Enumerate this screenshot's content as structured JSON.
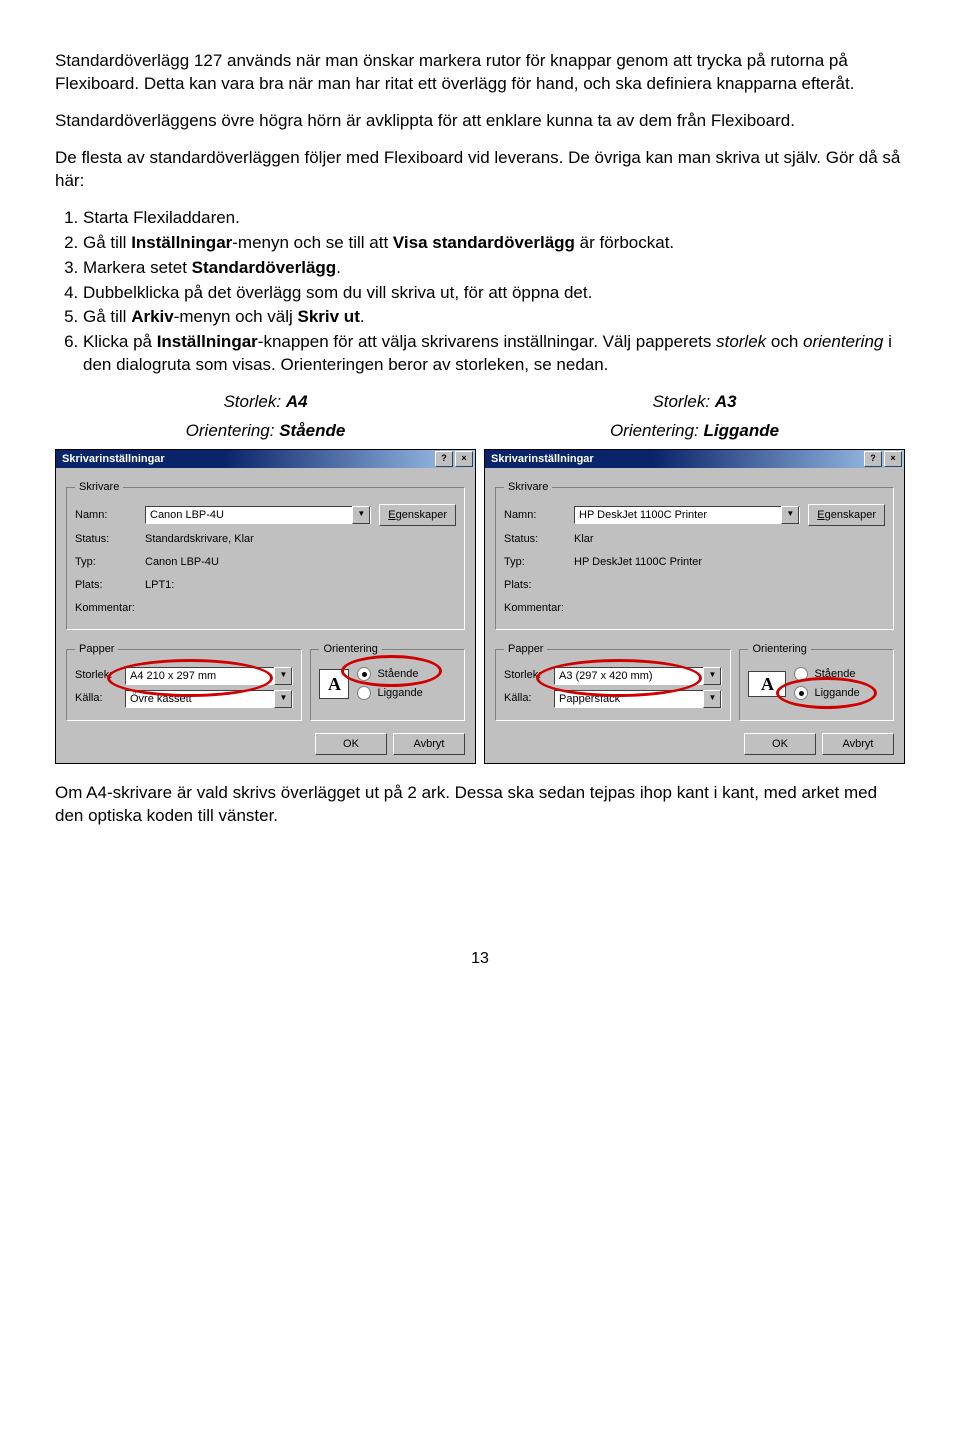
{
  "intro": {
    "p1": "Standardöverlägg 127 används när man önskar markera rutor för knappar genom att trycka på rutorna på Flexiboard. Detta kan vara bra när man har ritat ett överlägg för hand, och ska definiera knapparna efteråt.",
    "p2": "Standardöverläggens övre högra hörn är avklippta för att enklare kunna ta av dem från Flexiboard.",
    "p3": "De flesta av standardöverläggen följer med Flexiboard vid leverans. De övriga kan man skriva ut själv. Gör då så här:"
  },
  "steps": {
    "s1": "Starta Flexiladdaren.",
    "s2_a": "Gå till ",
    "s2_b": "Inställningar",
    "s2_c": "-menyn och se till att ",
    "s2_d": "Visa standardöverlägg",
    "s2_e": " är förbockat.",
    "s3_a": "Markera setet ",
    "s3_b": "Standardöverlägg",
    "s3_c": ".",
    "s4": "Dubbelklicka på det överlägg som du vill skriva ut, för att öppna det.",
    "s5_a": "Gå till ",
    "s5_b": "Arkiv",
    "s5_c": "-menyn och välj ",
    "s5_d": "Skriv ut",
    "s5_e": ".",
    "s6_a": "Klicka på ",
    "s6_b": "Inställningar",
    "s6_c": "-knappen för att välja skrivarens inställningar. Välj papperets ",
    "s6_d": "storlek",
    "s6_e": " och ",
    "s6_f": "orientering",
    "s6_g": " i den dialogruta som visas. Orienteringen beror av storleken, se nedan."
  },
  "headers": {
    "left1_a": "Storlek: ",
    "left1_b": "A4",
    "left2_a": "Orientering: ",
    "left2_b": "Stående",
    "right1_a": "Storlek: ",
    "right1_b": "A3",
    "right2_a": "Orientering: ",
    "right2_b": "Liggande"
  },
  "dlgL": {
    "title": "Skrivarinställningar",
    "grp_printer": "Skrivare",
    "lbl_name": "Namn:",
    "name_val": "Canon LBP-4U",
    "btn_props": "Egenskaper",
    "lbl_status": "Status:",
    "status_val": "Standardskrivare, Klar",
    "lbl_type": "Typ:",
    "type_val": "Canon LBP-4U",
    "lbl_place": "Plats:",
    "place_val": "LPT1:",
    "lbl_comment": "Kommentar:",
    "comment_val": "",
    "grp_paper": "Papper",
    "lbl_size": "Storlek:",
    "size_val": "A4 210 x 297 mm",
    "lbl_source": "Källa:",
    "source_val": "Övre kassett",
    "grp_orient": "Orientering",
    "opt1": "Stående",
    "opt2": "Liggande",
    "checked": "Stående",
    "btn_ok": "OK",
    "btn_cancel": "Avbryt",
    "help_icon": "?",
    "close_icon": "×",
    "a_char": "A"
  },
  "dlgR": {
    "title": "Skrivarinställningar",
    "grp_printer": "Skrivare",
    "lbl_name": "Namn:",
    "name_val": "HP DeskJet 1100C Printer",
    "btn_props": "Egenskaper",
    "lbl_status": "Status:",
    "status_val": "Klar",
    "lbl_type": "Typ:",
    "type_val": "HP DeskJet 1100C Printer",
    "lbl_place": "Plats:",
    "place_val": "",
    "lbl_comment": "Kommentar:",
    "comment_val": "",
    "grp_paper": "Papper",
    "lbl_size": "Storlek:",
    "size_val": "A3 (297 x 420 mm)",
    "lbl_source": "Källa:",
    "source_val": "Pappersfack",
    "grp_orient": "Orientering",
    "opt1": "Stående",
    "opt2": "Liggande",
    "checked": "Liggande",
    "btn_ok": "OK",
    "btn_cancel": "Avbryt",
    "help_icon": "?",
    "close_icon": "×",
    "a_char": "A"
  },
  "outro": "Om A4-skrivare är vald skrivs överlägget ut på 2 ark. Dessa ska sedan tejpas ihop kant i kant, med arket med den optiska koden till vänster.",
  "page_number": "13"
}
